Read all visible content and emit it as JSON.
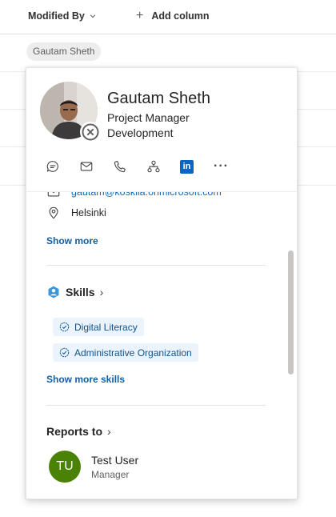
{
  "list": {
    "columns": [
      "Modified By",
      "Add column"
    ],
    "modified_by_chip": "Gautam Sheth"
  },
  "card": {
    "name": "Gautam Sheth",
    "job_title": "Project Manager",
    "department": "Development",
    "actions": [
      "chat-icon",
      "mail-icon",
      "phone-icon",
      "org-chart-icon",
      "linkedin-icon",
      "more-icon"
    ],
    "linkedin_text": "in",
    "more_text": "···",
    "email": "gautam@koskila.onmicrosoft.com",
    "location": "Helsinki",
    "show_more": "Show more",
    "skills": {
      "title": "Skills",
      "items": [
        "Digital Literacy",
        "Administrative Organization"
      ],
      "show_more": "Show more skills"
    },
    "reports_to": {
      "title": "Reports to",
      "initials": "TU",
      "name": "Test User",
      "role": "Manager",
      "avatar_color": "#498205"
    },
    "presence": "offline"
  },
  "colors": {
    "accent": "#115ea3",
    "linkedin": "#0a66c2",
    "skill_chip_bg": "#ebf3fc"
  }
}
